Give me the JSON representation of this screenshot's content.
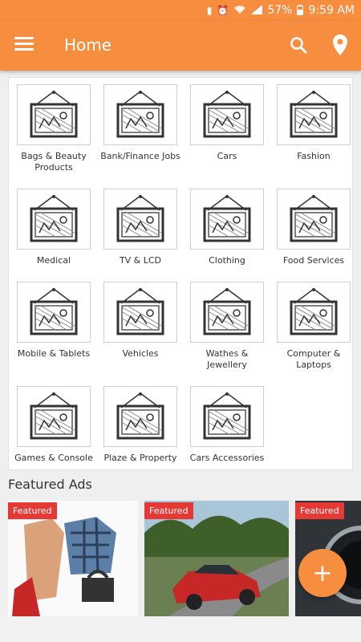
{
  "status_bar": {
    "battery": "57%",
    "time": "9:59 AM"
  },
  "app_bar": {
    "title": "Home",
    "accent_color": "#f68d3f"
  },
  "categories": [
    {
      "label": "Bags & Beauty Products"
    },
    {
      "label": "Bank/Finance Jobs"
    },
    {
      "label": "Cars"
    },
    {
      "label": "Fashion"
    },
    {
      "label": "Medical"
    },
    {
      "label": "TV & LCD"
    },
    {
      "label": "Clothing"
    },
    {
      "label": "Food Services"
    },
    {
      "label": "Mobile & Tablets"
    },
    {
      "label": "Vehicles"
    },
    {
      "label": "Wathes & Jewellery"
    },
    {
      "label": "Computer & Laptops"
    },
    {
      "label": "Games & Console"
    },
    {
      "label": "Plaze & Property"
    },
    {
      "label": "Cars Accessories"
    }
  ],
  "featured": {
    "title": "Featured Ads",
    "badge": "Featured",
    "badge_color": "#e53935"
  },
  "fab": {
    "icon": "plus-icon"
  }
}
